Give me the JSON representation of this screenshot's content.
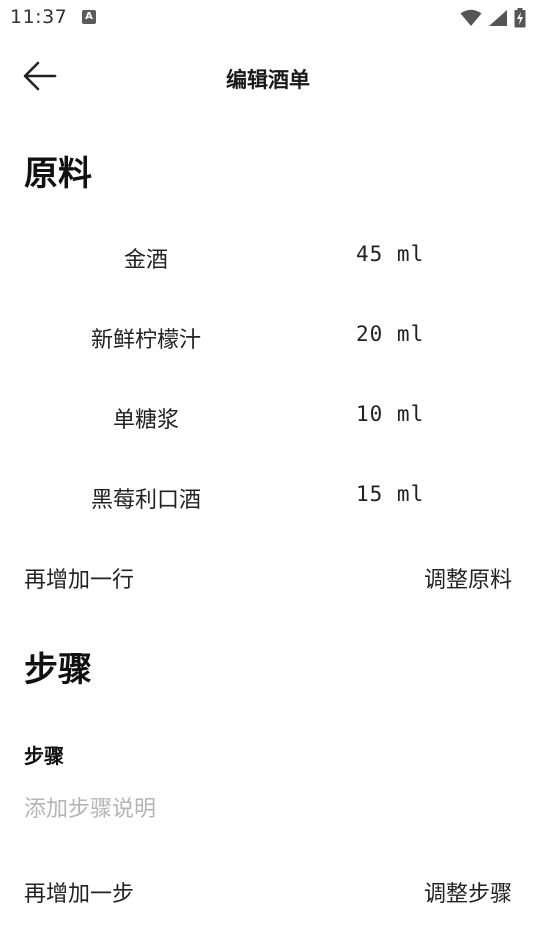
{
  "status_bar": {
    "time": "11:37",
    "notification_letter": "A"
  },
  "app_bar": {
    "title": "编辑酒单"
  },
  "ingredients_section": {
    "title": "原料",
    "items": [
      {
        "name": "金酒",
        "amount": "45 ml"
      },
      {
        "name": "新鲜柠檬汁",
        "amount": "20 ml"
      },
      {
        "name": "单糖浆",
        "amount": "10 ml"
      },
      {
        "name": "黑莓利口酒",
        "amount": "15 ml"
      }
    ],
    "add_row_label": "再增加一行",
    "adjust_label": "调整原料"
  },
  "steps_section": {
    "title": "步骤",
    "step_label": "步骤",
    "step_placeholder": "添加步骤说明",
    "step_value": "",
    "add_step_label": "再增加一步",
    "adjust_label": "调整步骤"
  }
}
